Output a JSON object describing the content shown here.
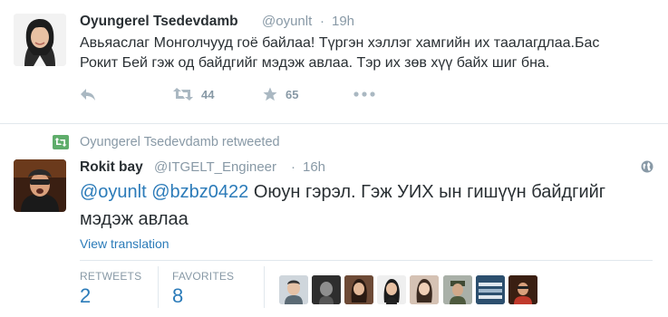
{
  "tweet1": {
    "display_name": "Oyungerel Tsedevdamb",
    "handle": "@oyunlt",
    "separator": "·",
    "time": "19h",
    "text": "Авьяаслаг Монголчууд гоё байлаа! Түргэн хэллэг хамгийн их таалагдлаа.Бас Рокит Бей гэж од байдгийг мэдэж авлаа. Тэр их зөв хүү байх шиг бна.",
    "actions": {
      "reply_icon": "reply-icon",
      "retweet_icon": "retweet-icon",
      "retweet_count": "44",
      "favorite_icon": "star-icon",
      "favorite_count": "65",
      "more_icon": "more-icon"
    }
  },
  "tweet2": {
    "retweet_context": "Oyungerel Tsedevdamb retweeted",
    "display_name": "Rokit bay",
    "handle": "@ITGELT_Engineer",
    "separator": "·",
    "time": "16h",
    "mention1": "@oyunlt",
    "mention2": "@bzbz0422",
    "text": " Оюун гэрэл. Гэж УИХ ын гишүүн байдгийг мэдэж авлаа",
    "view_translation": "View translation",
    "globe_icon": "globe-icon",
    "stats": {
      "retweets_label": "RETWEETS",
      "retweets_value": "2",
      "favorites_label": "FAVORITES",
      "favorites_value": "8"
    },
    "favoriters_count": 8
  },
  "colors": {
    "link": "#2b7bb9",
    "muted": "#8899a6",
    "icon": "#aab8c2",
    "retweet_green": "#5fad6b",
    "divider": "#e1e8ed"
  }
}
